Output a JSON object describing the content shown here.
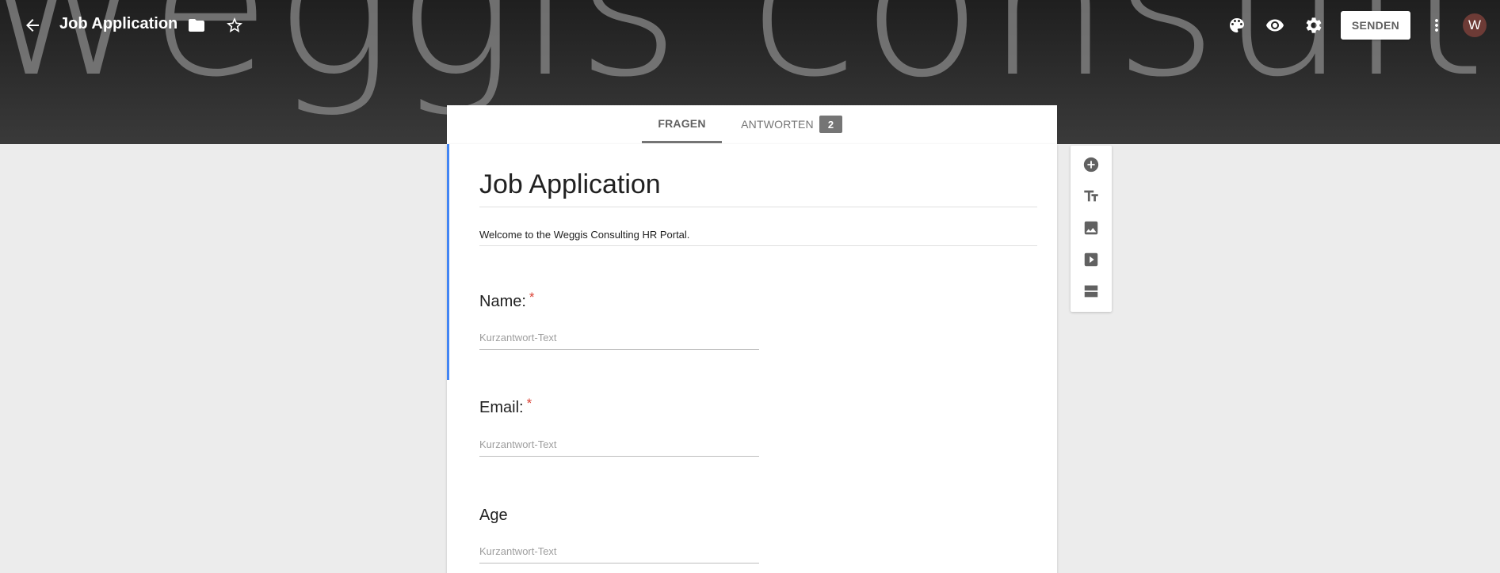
{
  "header": {
    "banner_text": "weggis consulting",
    "title": "Job Application",
    "send_label": "SENDEN",
    "avatar_initial": "W"
  },
  "tabs": {
    "questions_label": "FRAGEN",
    "responses_label": "ANTWORTEN",
    "responses_count": "2"
  },
  "form": {
    "title": "Job Application",
    "description": "Welcome to the Weggis Consulting HR Portal.",
    "questions": [
      {
        "label": "Name:",
        "required": "*",
        "placeholder": "Kurzantwort-Text"
      },
      {
        "label": "Email:",
        "required": "*",
        "placeholder": "Kurzantwort-Text"
      },
      {
        "label": "Age",
        "placeholder": "Kurzantwort-Text"
      }
    ]
  },
  "colors": {
    "accent": "#4285f4",
    "required": "#db4437",
    "avatar": "#6d3b36"
  },
  "icons": {
    "back": "arrow-back-icon",
    "folder": "folder-icon",
    "star": "star-outline-icon",
    "palette": "palette-icon",
    "preview": "eye-icon",
    "settings": "gear-icon",
    "more": "more-vert-icon",
    "add_question": "add-circle-icon",
    "add_title": "text-fields-icon",
    "add_image": "image-icon",
    "add_video": "video-icon",
    "add_section": "section-icon"
  }
}
